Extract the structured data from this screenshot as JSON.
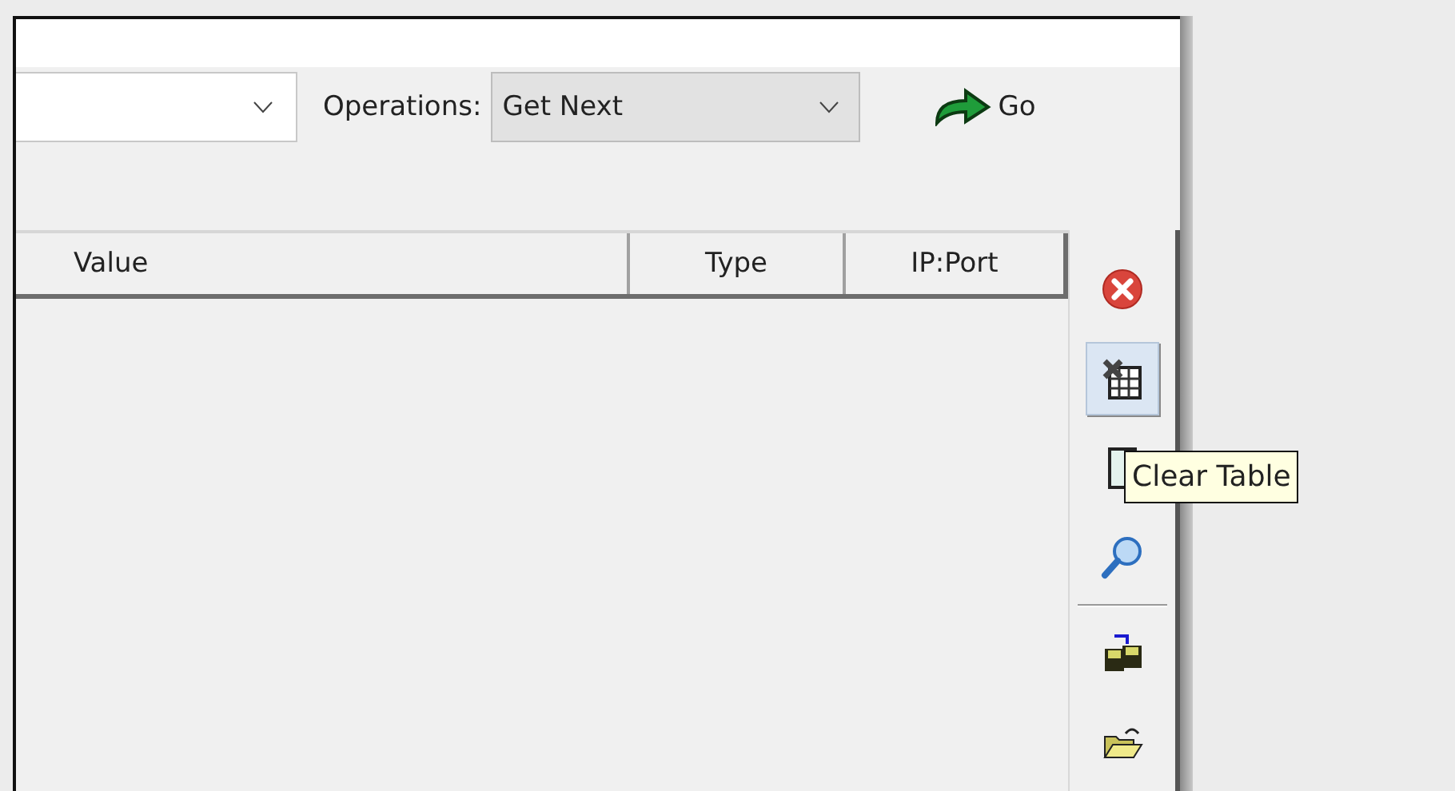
{
  "query_bar": {
    "operations_label": "Operations:",
    "operations_select": "Get Next",
    "go_button": "Go"
  },
  "table": {
    "columns": [
      {
        "label": "Value"
      },
      {
        "label": "Type"
      },
      {
        "label": "IP:Port"
      }
    ]
  },
  "side_toolbar": {
    "buttons": [
      {
        "kind": "stop",
        "hovered": false
      },
      {
        "kind": "clear-table",
        "hovered": true
      },
      {
        "kind": "list",
        "hovered": false
      },
      {
        "kind": "search",
        "hovered": false
      },
      {
        "kind": "separator"
      },
      {
        "kind": "save",
        "hovered": false
      },
      {
        "kind": "open",
        "hovered": false
      }
    ]
  },
  "tooltip": {
    "text": "Clear Table"
  }
}
